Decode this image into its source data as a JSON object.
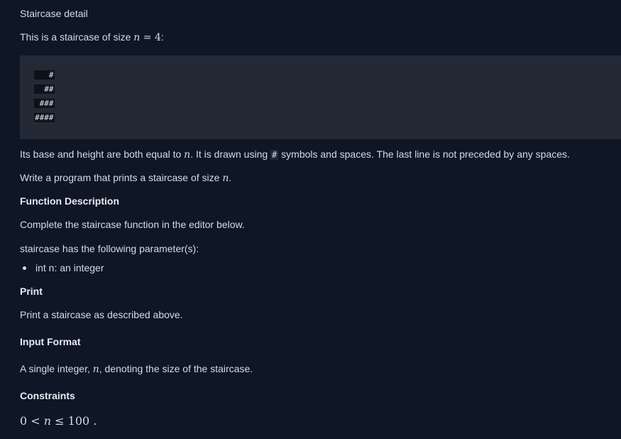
{
  "title": "Staircase detail",
  "intro": {
    "prefix": "This is a staircase of size ",
    "math_var": "n",
    "math_eq": " = 4",
    "suffix": ":"
  },
  "staircase_rows": [
    "   #",
    "  ##",
    " ###",
    "####"
  ],
  "description": {
    "prefix": "Its base and height are both equal to ",
    "math_var": "n",
    "mid": ". It is drawn using ",
    "code": "#",
    "suffix": " symbols and spaces. The last line is not preceded by any spaces."
  },
  "task": {
    "prefix": "Write a program that prints a staircase of size ",
    "math_var": "n",
    "suffix": "."
  },
  "function_description": {
    "heading": "Function Description",
    "text": "Complete the staircase function in the editor below.",
    "params_intro": "staircase has the following parameter(s):",
    "params": [
      "int n: an integer"
    ]
  },
  "print": {
    "heading": "Print",
    "text": "Print a staircase as described above."
  },
  "input_format": {
    "heading": "Input Format",
    "prefix": "A single integer, ",
    "math_var": "n",
    "suffix": ", denoting the size of the staircase."
  },
  "constraints": {
    "heading": "Constraints",
    "left": "0 < ",
    "math_var": "n",
    "right": " ≤ 100 ."
  }
}
